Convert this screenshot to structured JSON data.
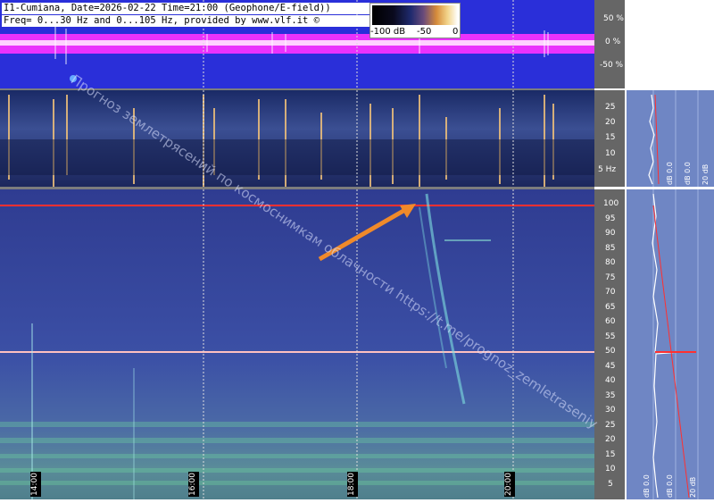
{
  "header": {
    "line1": "I1-Cumiana, Date=2026-02-22 Time=21:00 (Geophone/E-field))",
    "line2": "Freq= 0...30 Hz and 0...105 Hz, provided by www.vlf.it ©"
  },
  "colorbar": {
    "labels": [
      "-100 dB",
      "-50",
      "0"
    ]
  },
  "waveform_axis": {
    "ticks": [
      "50 %",
      "0 %",
      "-50 %"
    ]
  },
  "lf_axis": {
    "ticks": [
      "25",
      "20",
      "15",
      "10",
      "5 Hz"
    ]
  },
  "hf_axis": {
    "ticks": [
      "100",
      "95",
      "90",
      "85",
      "80",
      "75",
      "70",
      "65",
      "60",
      "55",
      "50",
      "45",
      "40",
      "35",
      "30",
      "25",
      "20",
      "15",
      "10",
      "5"
    ]
  },
  "time_labels": [
    "14:00",
    "16:00",
    "18:00",
    "20:00"
  ],
  "side_labels": {
    "lf": [
      "dB 0.0",
      "dB 0.0",
      "20 dB"
    ],
    "hf": [
      "dB 0.0",
      "dB 0.0",
      "20 dB"
    ]
  },
  "watermark": "Прогноз землетрясений по космоснимкам облачности   https://t.me/prognoz_zemletraseniy",
  "colors": {
    "wave_bg": "#2a2fd9",
    "wave_trace": "#ff00ff",
    "mains_line": "#ff2a2a",
    "arrow": "#f08a2a"
  }
}
